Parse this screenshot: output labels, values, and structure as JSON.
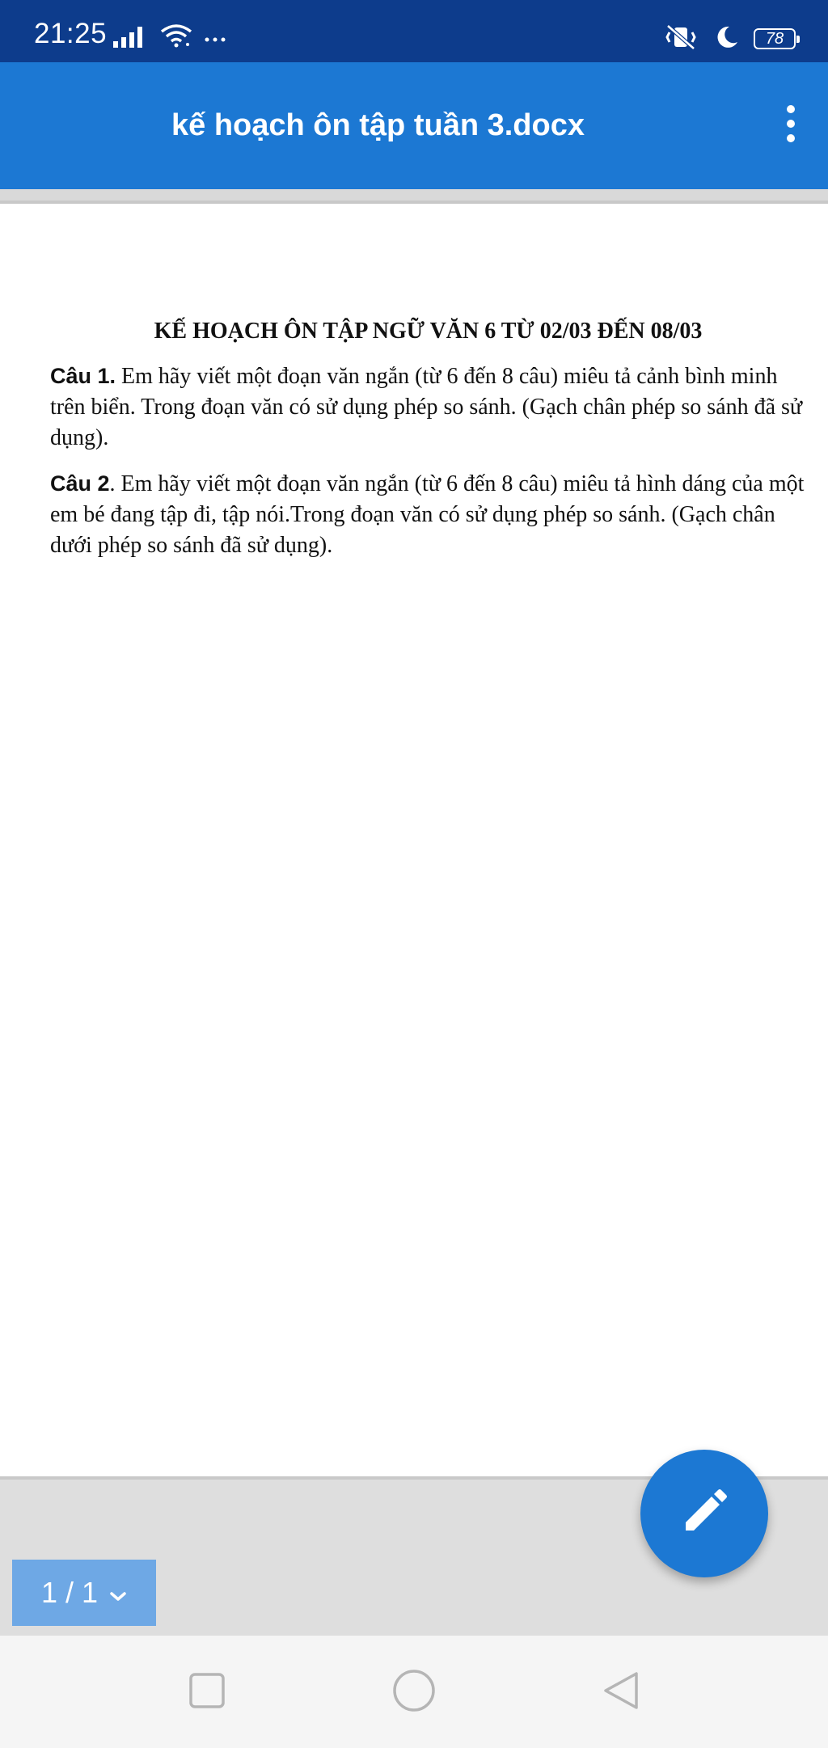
{
  "status_bar": {
    "time": "21:25",
    "battery": "78",
    "icons": [
      "signal-icon",
      "wifi-icon",
      "more-dots-icon",
      "vibrate-off-icon",
      "moon-icon",
      "battery-icon"
    ]
  },
  "app_bar": {
    "title": "kế hoạch ôn tập tuần 3.docx",
    "menu_icon": "more-vert-icon",
    "color": "#1c78d3"
  },
  "document": {
    "heading": "KẾ HOẠCH ÔN TẬP NGỮ VĂN 6 TỪ 02/03 ĐẾN 08/03",
    "questions": [
      {
        "label": "Câu 1.",
        "text": " Em hãy viết một đoạn văn ngắn (từ 6 đến 8 câu) miêu tả cảnh bình minh trên biển. Trong đoạn văn  có sử dụng phép so sánh. (Gạch chân phép so sánh đã sử dụng)."
      },
      {
        "label": "Câu 2",
        "text": ". Em hãy viết một đoạn văn ngắn (từ 6 đến 8 câu) miêu tả hình dáng của một em bé đang tập đi, tập nói.Trong đoạn văn có sử dụng phép so sánh. (Gạch chân dưới phép so sánh đã sử dụng)."
      }
    ]
  },
  "pager": {
    "label": "1 / 1"
  },
  "fab": {
    "icon": "edit-pencil-icon"
  },
  "nav_bar": {
    "buttons": [
      "recents-square-icon",
      "home-circle-icon",
      "back-triangle-icon"
    ]
  }
}
